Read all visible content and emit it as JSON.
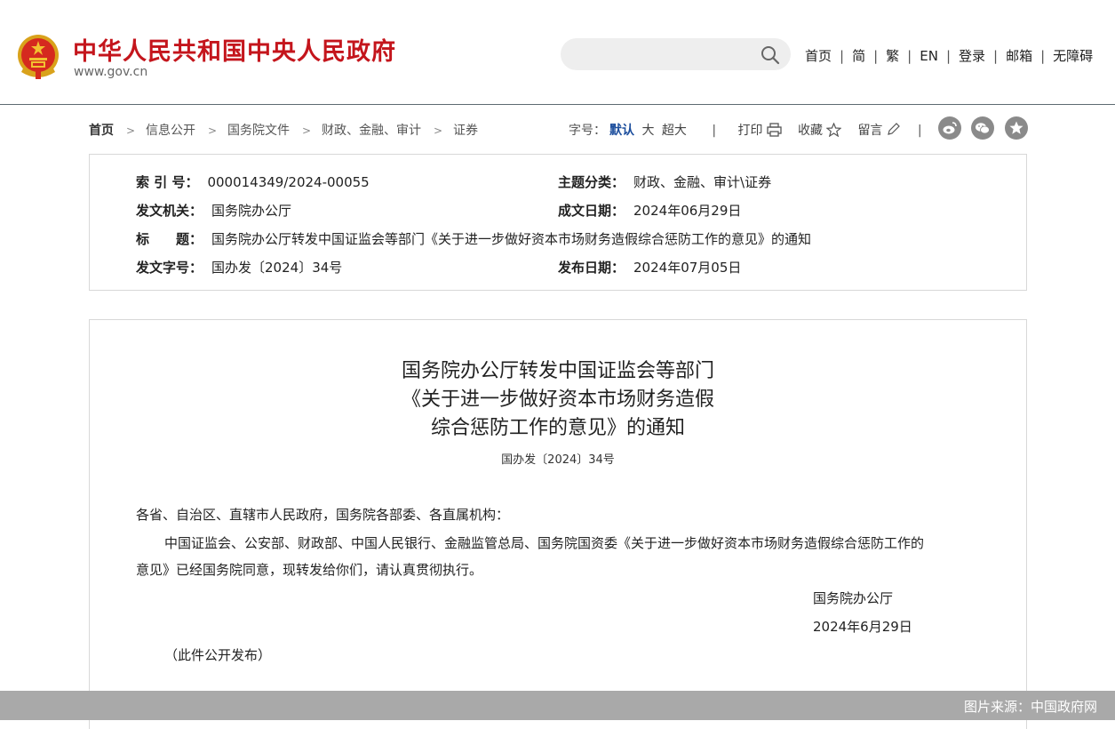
{
  "header": {
    "site_title": "中华人民共和国中央人民政府",
    "site_url": "www.gov.cn",
    "search_placeholder": "",
    "nav": [
      "首页",
      "简",
      "繁",
      "EN",
      "登录",
      "邮箱",
      "无障碍"
    ]
  },
  "breadcrumb": [
    "首页",
    "信息公开",
    "国务院文件",
    "财政、金融、审计",
    "证券"
  ],
  "tools": {
    "font_size_label": "字号：",
    "sizes": [
      "默认",
      "大",
      "超大"
    ],
    "active_size": "默认",
    "print": "打印",
    "favorite": "收藏",
    "comment": "留言",
    "share_icons": [
      "weibo-icon",
      "wechat-icon",
      "star-icon"
    ]
  },
  "meta": {
    "index_label": "索 引 号：",
    "index_value": "000014349/2024-00055",
    "topic_label": "主题分类：",
    "topic_value": "财政、金融、审计\\证券",
    "issuer_label": "发文机关：",
    "issuer_value": "国务院办公厅",
    "date_written_label": "成文日期：",
    "date_written_value": "2024年06月29日",
    "title_label": "标　　题：",
    "title_value": "国务院办公厅转发中国证监会等部门《关于进一步做好资本市场财务造假综合惩防工作的意见》的通知",
    "doc_no_label": "发文字号：",
    "doc_no_value": "国办发〔2024〕34号",
    "publish_label": "发布日期：",
    "publish_value": "2024年07月05日"
  },
  "article": {
    "title_lines": [
      "国务院办公厅转发中国证监会等部门",
      "《关于进一步做好资本市场财务造假",
      "综合惩防工作的意见》的通知"
    ],
    "doc_no": "国办发〔2024〕34号",
    "salutation": "各省、自治区、直辖市人民政府，国务院各部委、各直属机构：",
    "body_line1": "中国证监会、公安部、财政部、中国人民银行、金融监管总局、国务院国资委《关于进一步做好资本市场财务造假综合惩防工作的",
    "body_line2": "意见》已经国务院同意，现转发给你们，请认真贯彻执行。",
    "signer": "国务院办公厅",
    "sign_date": "2024年6月29日",
    "note": "（此件公开发布）"
  },
  "footer": {
    "source": "图片来源：中国政府网"
  },
  "colors": {
    "brand_red": "#c4151c",
    "link_blue": "#1c4e9d",
    "footer_gray": "#a9a9a9"
  }
}
